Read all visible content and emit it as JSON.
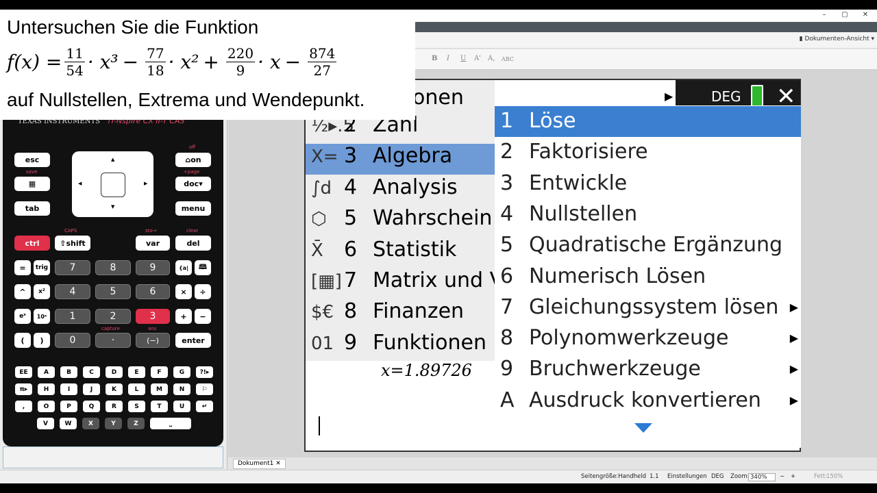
{
  "task": {
    "line1": "Untersuchen Sie die Funktion",
    "fx": "f(x) =",
    "t1_num": "11",
    "t1_den": "54",
    "t1_var": "· x³",
    "op1": "−",
    "t2_num": "77",
    "t2_den": "18",
    "t2_var": "· x²",
    "op2": "+",
    "t3_num": "220",
    "t3_den": "9",
    "t3_var": "· x",
    "op3": "−",
    "t4_num": "874",
    "t4_den": "27",
    "line3": "auf Nullstellen, Extrema und Wendepunkt."
  },
  "window": {
    "minimize": "–",
    "maximize": "▢",
    "close": "✕",
    "doc_view": "Dokumenten-Ansicht"
  },
  "toolbar": {
    "bold": "B",
    "italic": "I",
    "underline": "U",
    "sup": "A'",
    "sub": "A,",
    "abc": "ABC"
  },
  "handheld": {
    "brand": "TEXAS INSTRUMENTS",
    "model": "TI-Nspire CX II-T CAS",
    "keys": {
      "esc": "esc",
      "on": "⌂on",
      "scratch": "▦",
      "doc": "doc▾",
      "tab": "tab",
      "menu": "menu",
      "ctrl": "ctrl",
      "shift": "⇧shift",
      "var": "var",
      "del": "del",
      "eq": "=",
      "trig": "trig",
      "caret": "^",
      "x2": "x²",
      "ex": "eˣ",
      "10x": "10ˣ",
      "lp": "(",
      "rp": ")",
      "templ": "{a|",
      "book": "🕮",
      "mul": "×",
      "div": "÷",
      "plus": "+",
      "minus": "−",
      "enter": "enter",
      "n7": "7",
      "n8": "8",
      "n9": "9",
      "n4": "4",
      "n5": "5",
      "n6": "6",
      "n1": "1",
      "n2": "2",
      "n3": "3",
      "n0": "0",
      "dot": "·",
      "neg": "(−)"
    },
    "labels": {
      "off": "off",
      "save": "save",
      "page": "+page",
      "caps": "CAPS",
      "sto": "sto→",
      "clear": "clear",
      "capture": "capture",
      "ans": "ans"
    },
    "alpha_rows": [
      [
        "EE",
        "A",
        "B",
        "C",
        "D",
        "E",
        "F",
        "G",
        "?!▸"
      ],
      [
        "π▸",
        "H",
        "I",
        "J",
        "K",
        "L",
        "M",
        "N",
        "⚐"
      ],
      [
        ",",
        "O",
        "P",
        "Q",
        "R",
        "S",
        "T",
        "U",
        "↵"
      ],
      [
        "V",
        "W",
        "X",
        "Y",
        "Z",
        "⎵"
      ]
    ]
  },
  "screen": {
    "deg": "DEG",
    "close": "✕",
    "menu1_top": "onen",
    "menu1": [
      {
        "icon": "½▸.5",
        "num": "2",
        "label": "Zahl"
      },
      {
        "icon": "X=",
        "num": "3",
        "label": "Algebra"
      },
      {
        "icon": "∫d",
        "num": "4",
        "label": "Analysis"
      },
      {
        "icon": "⬡",
        "num": "5",
        "label": "Wahrschein"
      },
      {
        "icon": "X̄",
        "num": "6",
        "label": "Statistik"
      },
      {
        "icon": "[▦]",
        "num": "7",
        "label": "Matrix und V"
      },
      {
        "icon": "$€",
        "num": "8",
        "label": "Finanzen"
      },
      {
        "icon": "01",
        "num": "9",
        "label": "Funktionen u"
      }
    ],
    "result": "x=1.89726",
    "menu2": [
      {
        "num": "1",
        "label": "Löse",
        "arrow": ""
      },
      {
        "num": "2",
        "label": "Faktorisiere",
        "arrow": ""
      },
      {
        "num": "3",
        "label": "Entwickle",
        "arrow": ""
      },
      {
        "num": "4",
        "label": "Nullstellen",
        "arrow": ""
      },
      {
        "num": "5",
        "label": "Quadratische Ergänzung",
        "arrow": ""
      },
      {
        "num": "6",
        "label": "Numerisch Lösen",
        "arrow": ""
      },
      {
        "num": "7",
        "label": "Gleichungssystem lösen",
        "arrow": "▶"
      },
      {
        "num": "8",
        "label": "Polynomwerkzeuge",
        "arrow": "▶"
      },
      {
        "num": "9",
        "label": "Bruchwerkzeuge",
        "arrow": "▶"
      },
      {
        "num": "A",
        "label": "Ausdruck konvertieren",
        "arrow": "▶"
      }
    ]
  },
  "status": {
    "doc_tab": "Dokument1",
    "page_size": "Seitengröße:Handheld",
    "page_num": "1.1",
    "settings": "Einstellungen",
    "angle": "DEG",
    "zoom_label": "Zoom:",
    "zoom_value": "340%",
    "bold_label": "Fett:",
    "bold_value": "150%"
  },
  "colors": {
    "accent": "#3a7fd0",
    "handheld_red": "#e0304a",
    "menu_highlight": "#6e9ad6"
  }
}
